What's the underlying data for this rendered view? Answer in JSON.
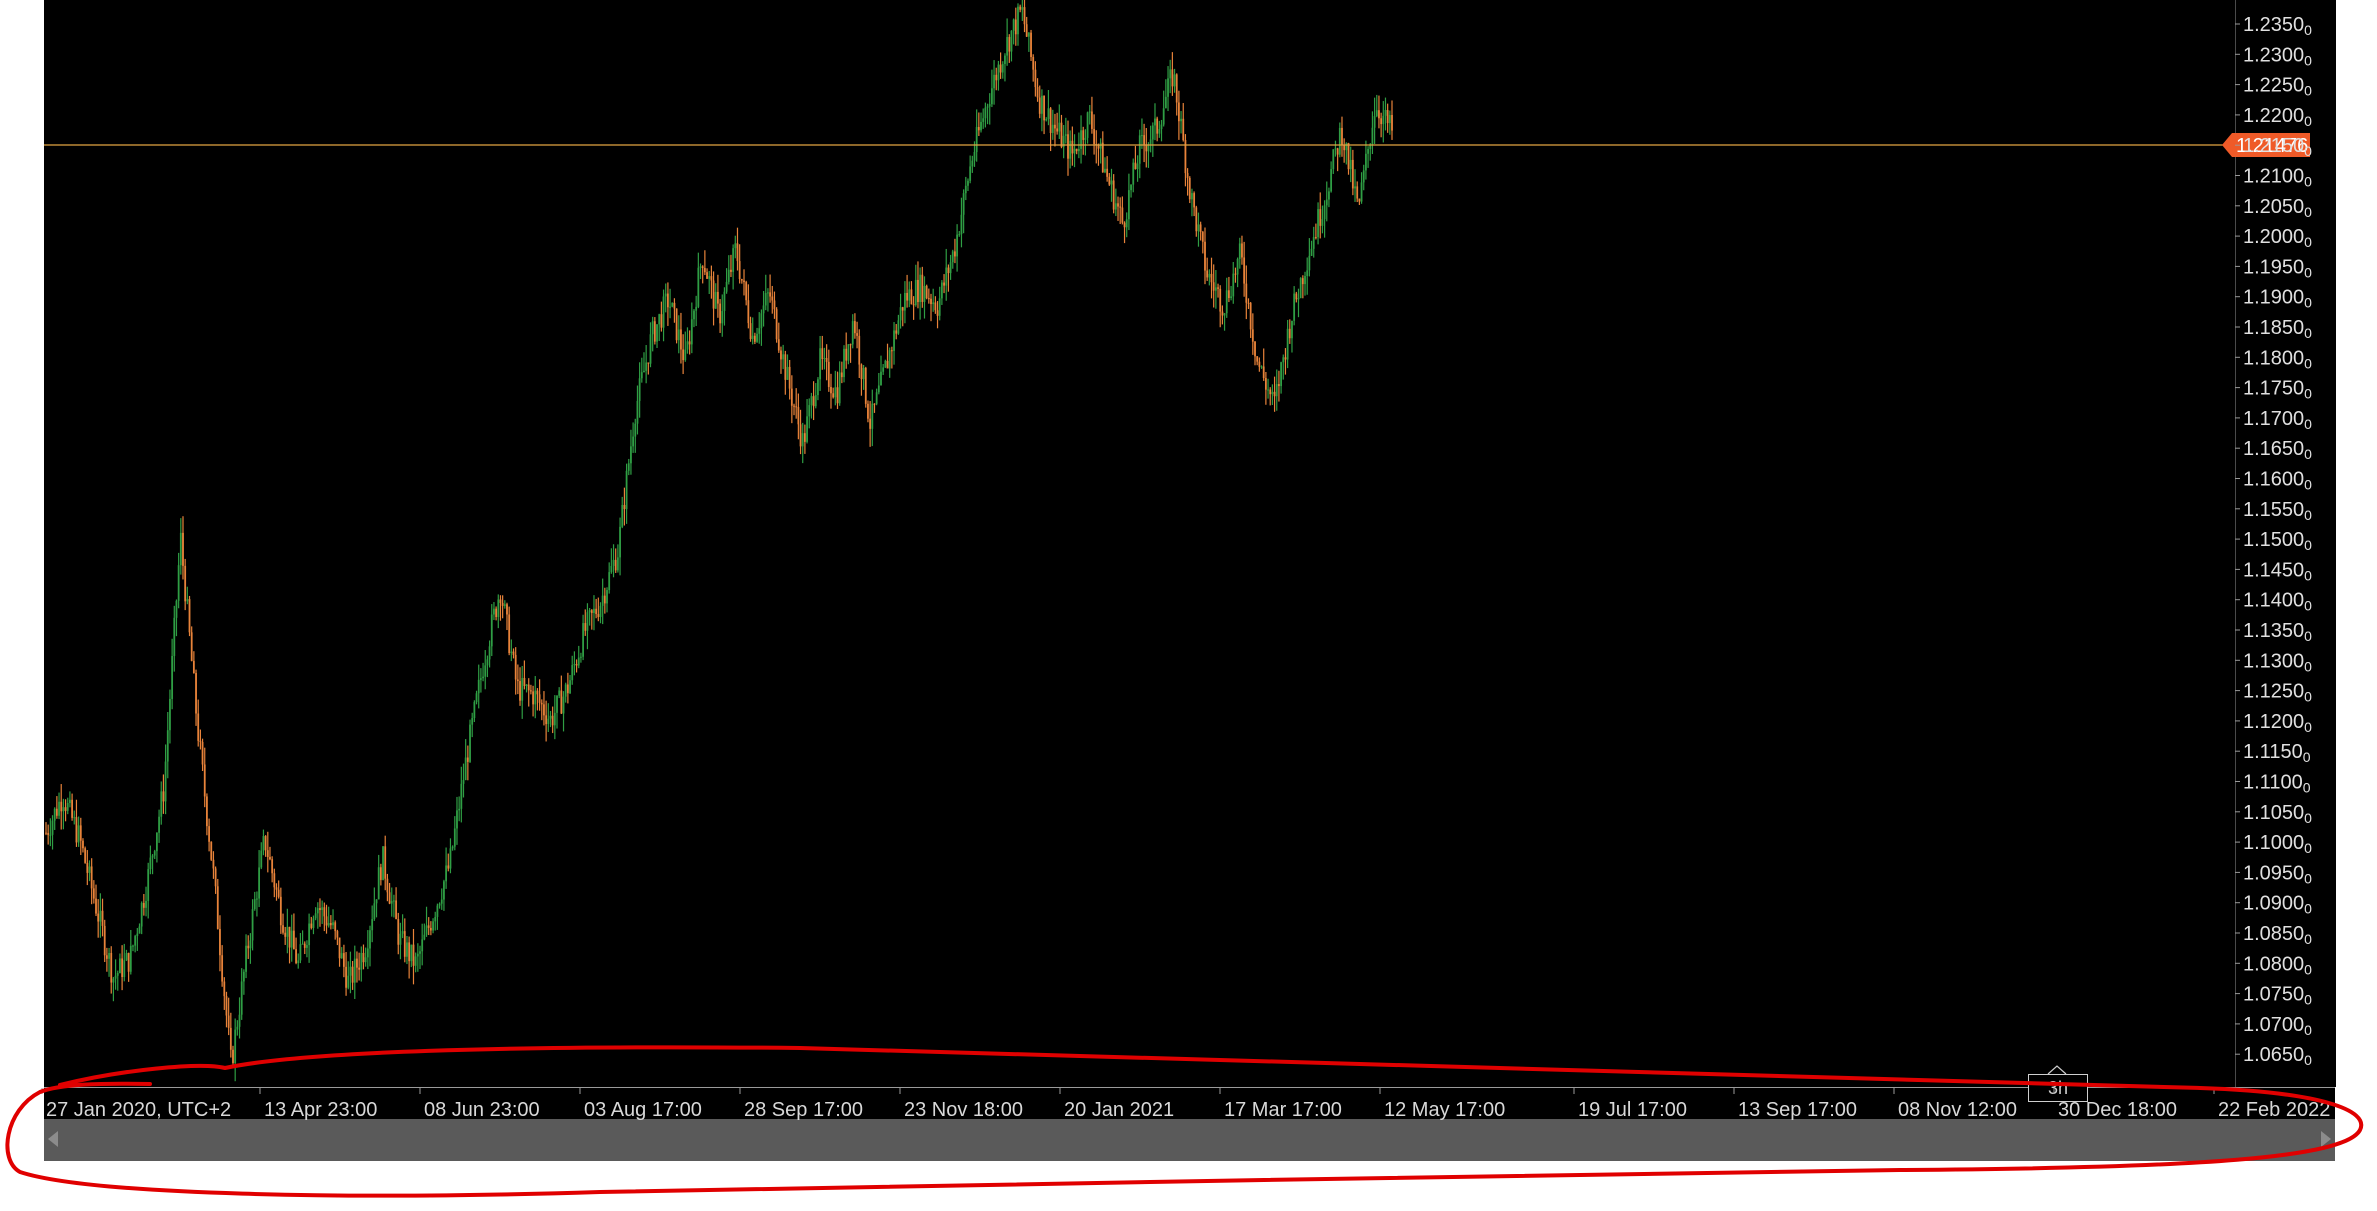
{
  "chart_data": {
    "type": "candlestick",
    "symbol_current_price": "1.21476",
    "y_axis": {
      "labels": [
        "1.2350",
        "1.2300",
        "1.2250",
        "1.2200",
        "1.2150",
        "1.2100",
        "1.2050",
        "1.2000",
        "1.1950",
        "1.1900",
        "1.1850",
        "1.1800",
        "1.1750",
        "1.1700",
        "1.1650",
        "1.1600",
        "1.1550",
        "1.1500",
        "1.1450",
        "1.1400",
        "1.1350",
        "1.1300",
        "1.1250",
        "1.1200",
        "1.1150",
        "1.1100",
        "1.1050",
        "1.1000",
        "1.0950",
        "1.0900",
        "1.0850",
        "1.0800",
        "1.0750",
        "1.0700",
        "1.0650"
      ],
      "subscript_digit": "0"
    },
    "x_axis": {
      "labels": [
        "27 Jan 2020, UTC+2",
        "13 Apr 23:00",
        "08 Jun 23:00",
        "03 Aug 17:00",
        "28 Sep 17:00",
        "23 Nov 18:00",
        "20 Jan 2021",
        "17 Mar 17:00",
        "12 May 17:00",
        "19 Jul 17:00",
        "13 Sep 17:00",
        "08 Nov 12:00",
        "30 Dec 18:00",
        "22 Feb 2022"
      ]
    },
    "series": [
      {
        "values": [
          1.103,
          1.109,
          1.102,
          1.091,
          1.08,
          1.083,
          1.095,
          1.11,
          1.15,
          1.12,
          1.095,
          1.066,
          1.085,
          1.102,
          1.09,
          1.082,
          1.092,
          1.088,
          1.079,
          1.085,
          1.099,
          1.086,
          1.082,
          1.09,
          1.098,
          1.115,
          1.13,
          1.142,
          1.126,
          1.125,
          1.121,
          1.126,
          1.135,
          1.14,
          1.148,
          1.17,
          1.182,
          1.188,
          1.178,
          1.195,
          1.185,
          1.196,
          1.182,
          1.189,
          1.176,
          1.165,
          1.178,
          1.173,
          1.185,
          1.168,
          1.178,
          1.188,
          1.19,
          1.187,
          1.196,
          1.21,
          1.22,
          1.228,
          1.234,
          1.22,
          1.215,
          1.211,
          1.217,
          1.208,
          1.2,
          1.212,
          1.215,
          1.224,
          1.205,
          1.192,
          1.187,
          1.195,
          1.178,
          1.171,
          1.185,
          1.195,
          1.204,
          1.215,
          1.202,
          1.219,
          1.2147
        ]
      }
    ],
    "colors": {
      "background": "#000000",
      "bull": "#2f9e44",
      "bear": "#e8833a",
      "current_line": "#e3a542",
      "current_badge": "#ef5a28",
      "annotation": "#e00000"
    }
  },
  "ui": {
    "timeframe_label": "3h",
    "annotation": "red-freehand-ellipse-around-time-axis"
  }
}
